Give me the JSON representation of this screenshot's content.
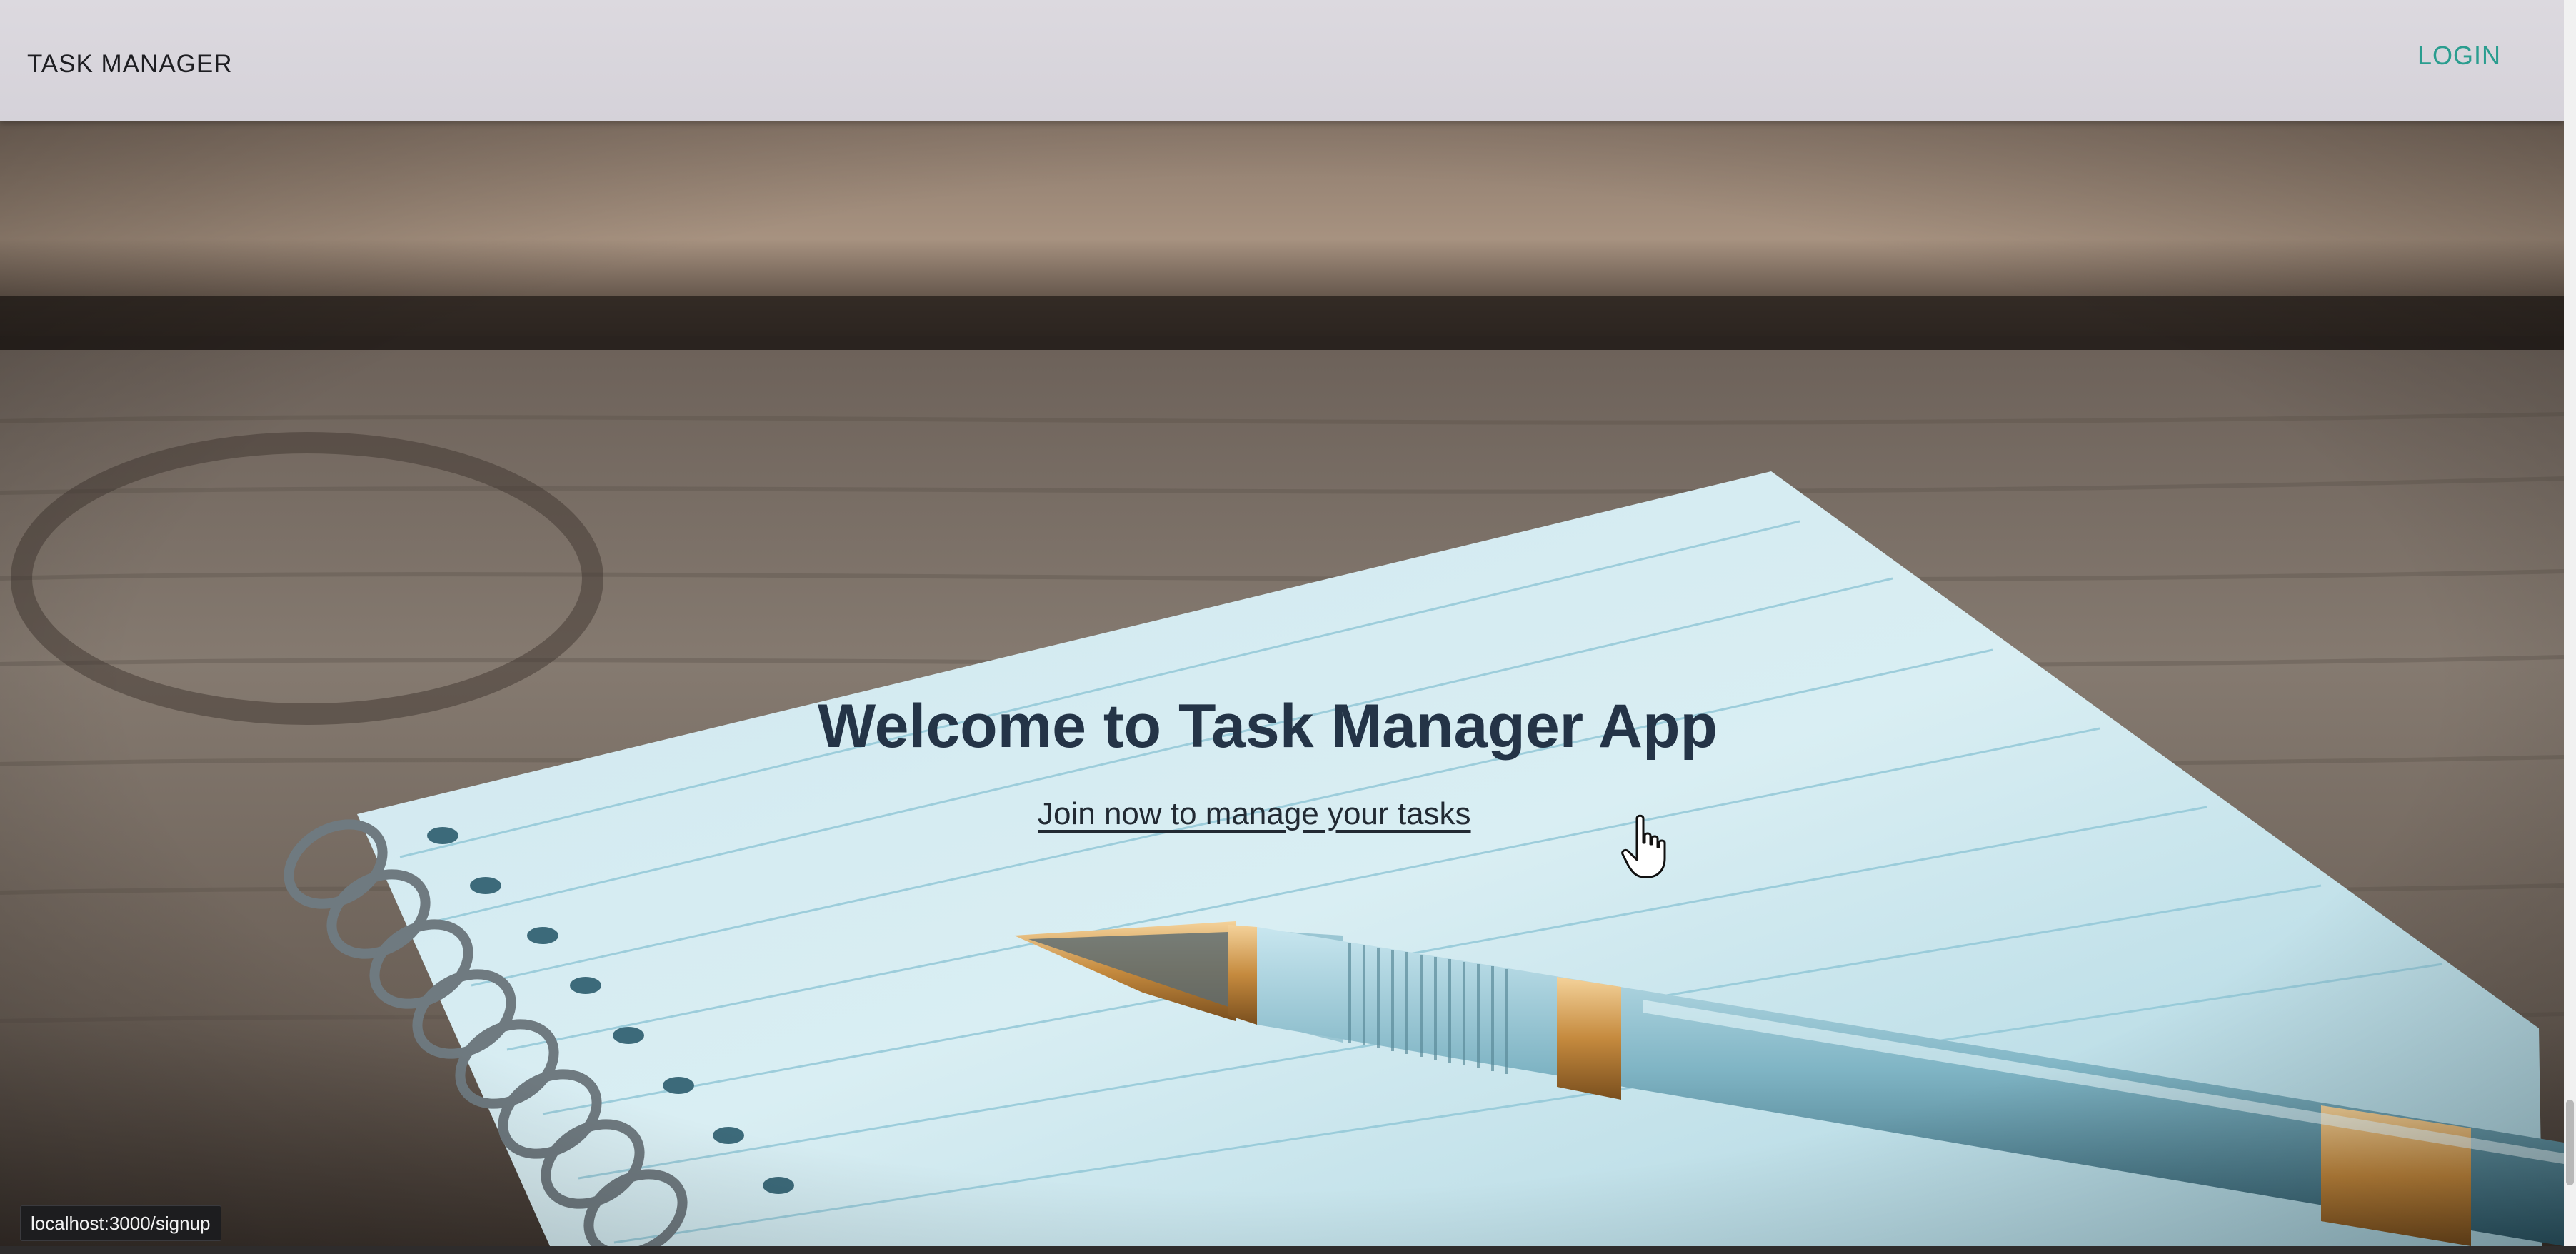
{
  "navbar": {
    "brand": "TASK MANAGER",
    "login_label": "LOGIN"
  },
  "hero": {
    "title": "Welcome to Task Manager App",
    "cta_link": "Join now to manage your tasks",
    "background": "notebook-and-fountain-pen-photo"
  },
  "status_bar": {
    "url": "localhost:3000/signup"
  },
  "cursor": {
    "icon": "hand-pointer-icon"
  },
  "colors": {
    "accent": "#2a9d8f",
    "title": "#243447",
    "navbar_bg": "#d8d5dc"
  }
}
